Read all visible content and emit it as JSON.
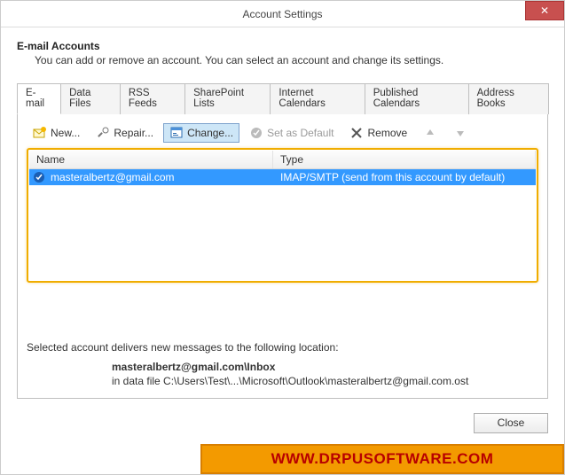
{
  "window": {
    "title": "Account Settings",
    "close_glyph": "✕"
  },
  "header": {
    "title": "E-mail Accounts",
    "description": "You can add or remove an account. You can select an account and change its settings."
  },
  "tabs": [
    {
      "label": "E-mail",
      "active": true
    },
    {
      "label": "Data Files"
    },
    {
      "label": "RSS Feeds"
    },
    {
      "label": "SharePoint Lists"
    },
    {
      "label": "Internet Calendars"
    },
    {
      "label": "Published Calendars"
    },
    {
      "label": "Address Books"
    }
  ],
  "toolbar": {
    "new_label": "New...",
    "repair_label": "Repair...",
    "change_label": "Change...",
    "default_label": "Set as Default",
    "remove_label": "Remove"
  },
  "list": {
    "col_name": "Name",
    "col_type": "Type",
    "rows": [
      {
        "name": "masteralbertz@gmail.com",
        "type": "IMAP/SMTP (send from this account by default)"
      }
    ]
  },
  "delivery": {
    "intro": "Selected account delivers new messages to the following location:",
    "location_main": "masteralbertz@gmail.com\\Inbox",
    "location_path": "in data file C:\\Users\\Test\\...\\Microsoft\\Outlook\\masteralbertz@gmail.com.ost"
  },
  "footer": {
    "close_label": "Close"
  },
  "watermark": {
    "text": "WWW.DRPUSOFTWARE.COM"
  }
}
